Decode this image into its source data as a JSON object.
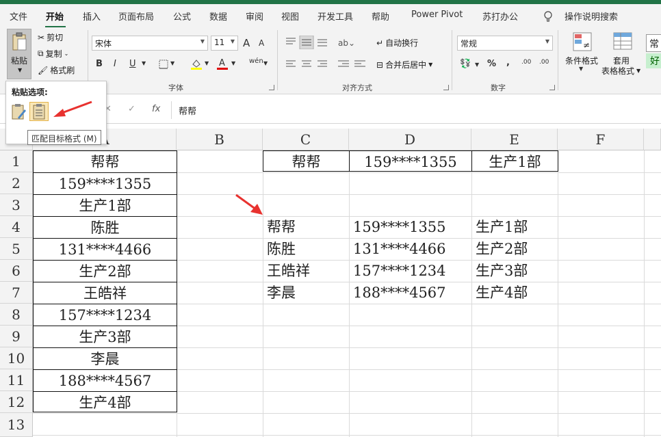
{
  "tabs": [
    "文件",
    "开始",
    "插入",
    "页面布局",
    "公式",
    "数据",
    "审阅",
    "视图",
    "开发工具",
    "帮助",
    "Power Pivot",
    "苏打办公"
  ],
  "tell_me": "操作说明搜索",
  "ribbon": {
    "clipboard": {
      "paste": "粘贴",
      "cut": "剪切",
      "copy": "复制",
      "format_painter": "格式刷"
    },
    "font": {
      "label": "字体",
      "name": "宋体",
      "size": "11",
      "bold": "B",
      "italic": "I",
      "underline": "U",
      "grow": "A",
      "shrink": "A",
      "phonetic": "wén"
    },
    "alignment": {
      "label": "对齐方式",
      "wrap": "自动换行",
      "merge": "合并后居中"
    },
    "number": {
      "label": "数字",
      "format": "常规",
      "percent": "%",
      "comma": ",",
      "inc": ".00",
      "dec": ".00"
    },
    "styles": {
      "conditional": "条件格式",
      "table_format_1": "套用",
      "table_format_2": "表格格式",
      "normal": "常",
      "good": "好"
    }
  },
  "paste_popup": {
    "title": "粘贴选项:",
    "tooltip": "匹配目标格式 (M)"
  },
  "formula_bar": {
    "fx": "fx",
    "value": "帮帮"
  },
  "columns": [
    "A",
    "B",
    "C",
    "D",
    "E",
    "F"
  ],
  "rows": [
    "1",
    "2",
    "3",
    "4",
    "5",
    "6",
    "7",
    "8",
    "9",
    "10",
    "11",
    "12",
    "13"
  ],
  "colA": [
    "帮帮",
    "159****1355",
    "生产1部",
    "陈胜",
    "131****4466",
    "生产2部",
    "王皓祥",
    "157****1234",
    "生产3部",
    "李晨",
    "188****4567",
    "生产4部"
  ],
  "row1": {
    "C": "帮帮",
    "D": "159****1355",
    "E": "生产1部"
  },
  "table": [
    {
      "name": "帮帮",
      "phone": "159****1355",
      "dept": "生产1部"
    },
    {
      "name": "陈胜",
      "phone": "131****4466",
      "dept": "生产2部"
    },
    {
      "name": "王皓祥",
      "phone": "157****1234",
      "dept": "生产3部"
    },
    {
      "name": "李晨",
      "phone": "188****4567",
      "dept": "生产4部"
    }
  ],
  "colors": {
    "accent": "#217346",
    "arrow": "#e8322f",
    "highlight": "#f9e7b7"
  }
}
